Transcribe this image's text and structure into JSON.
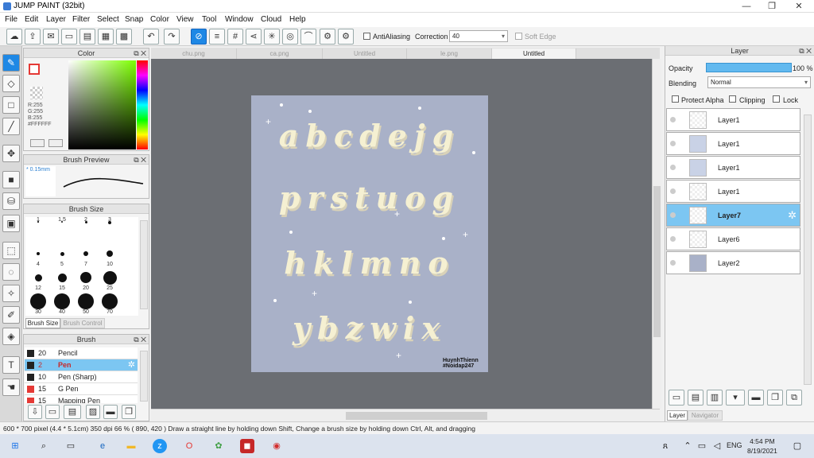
{
  "window": {
    "title": "JUMP PAINT (32bit)"
  },
  "menu": [
    "File",
    "Edit",
    "Layer",
    "Filter",
    "Select",
    "Snap",
    "Color",
    "View",
    "Tool",
    "Window",
    "Cloud",
    "Help"
  ],
  "toolbar": {
    "antialiasing": "AntiAliasing",
    "correction_label": "Correction",
    "correction_value": "40",
    "soft_edge": "Soft Edge"
  },
  "color_panel": {
    "title": "Color",
    "r": "R:255",
    "g": "G:255",
    "b": "B:255",
    "hex": "#FFFFFF"
  },
  "brush_preview": {
    "title": "Brush Preview",
    "size": "0.15mm"
  },
  "brush_size": {
    "title": "Brush Size",
    "sizes": [
      "1",
      "1.5",
      "2",
      "3",
      "4",
      "5",
      "7",
      "10",
      "12",
      "15",
      "20",
      "25",
      "30",
      "40",
      "50",
      "70"
    ],
    "tab1": "Brush Size",
    "tab2": "Brush Control"
  },
  "brush_list": {
    "title": "Brush",
    "items": [
      {
        "size": "20",
        "name": "Pencil",
        "color": "#222"
      },
      {
        "size": "2",
        "name": "Pen",
        "color": "#222",
        "selected": true
      },
      {
        "size": "10",
        "name": "Pen (Sharp)",
        "color": "#222"
      },
      {
        "size": "15",
        "name": "G Pen",
        "color": "#e53935"
      },
      {
        "size": "15",
        "name": "Mapping Pen",
        "color": "#e53935"
      }
    ]
  },
  "doc_tabs": [
    "chu.png",
    "ca.png",
    "Untitled",
    "le.png",
    "Untitled"
  ],
  "artwork": {
    "rows": [
      "abcdejg",
      "prstuog",
      "hklmno",
      "ybzwix"
    ],
    "signature_line1": "HuynhThienn",
    "signature_line2": "#Noidap247"
  },
  "layer_panel": {
    "title": "Layer",
    "opacity_label": "Opacity",
    "opacity_value": "100 %",
    "blending_label": "Blending",
    "blending_value": "Normal",
    "protect_alpha": "Protect Alpha",
    "clipping": "Clipping",
    "lock": "Lock",
    "layers": [
      "Layer1",
      "Layer1",
      "Layer1",
      "Layer1",
      "Layer7",
      "Layer6",
      "Layer2"
    ],
    "tabs": [
      "Layer",
      "Navigator"
    ]
  },
  "status": {
    "text": "600 * 700 pixel   (4.4 * 5.1cm)   350 dpi   66 %   ( 890, 420 )   Draw a straight line by holding down Shift, Change a brush size by holding down Ctrl, Alt, and dragging"
  },
  "taskbar": {
    "lang": "ENG",
    "time": "4:54 PM",
    "date": "8/19/2021"
  }
}
